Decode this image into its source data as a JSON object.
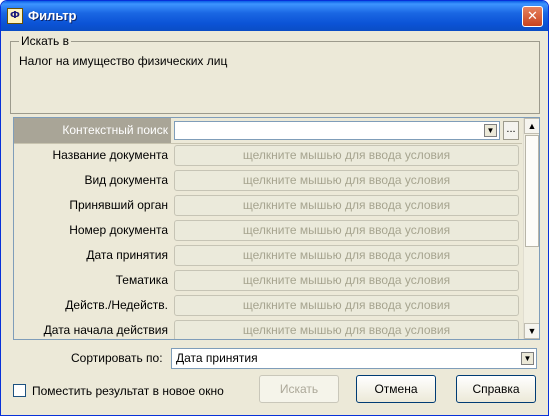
{
  "window": {
    "title": "Фильтр",
    "close_glyph": "✕"
  },
  "search_group": {
    "legend": "Искать в",
    "text": "Налог на имущество физических лиц"
  },
  "filter": {
    "context_label": "Контекстный поиск",
    "context_value": "",
    "more_label": "...",
    "placeholder": "щелкните мышью для ввода условия",
    "rows": [
      {
        "label": "Название документа"
      },
      {
        "label": "Вид документа"
      },
      {
        "label": "Принявший орган"
      },
      {
        "label": "Номер документа"
      },
      {
        "label": "Дата принятия"
      },
      {
        "label": "Тематика"
      },
      {
        "label": "Действ./Недейств."
      },
      {
        "label": "Дата начала действия"
      }
    ]
  },
  "sort": {
    "label": "Сортировать по:",
    "value": "Дата принятия"
  },
  "options": {
    "new_window_label": "Поместить результат в новое окно",
    "new_window_checked": false
  },
  "buttons": {
    "search": "Искать",
    "cancel": "Отмена",
    "help": "Справка"
  },
  "icons": {
    "dropdown": "▼",
    "scroll_up": "▲",
    "scroll_down": "▼",
    "app": "Ф"
  }
}
